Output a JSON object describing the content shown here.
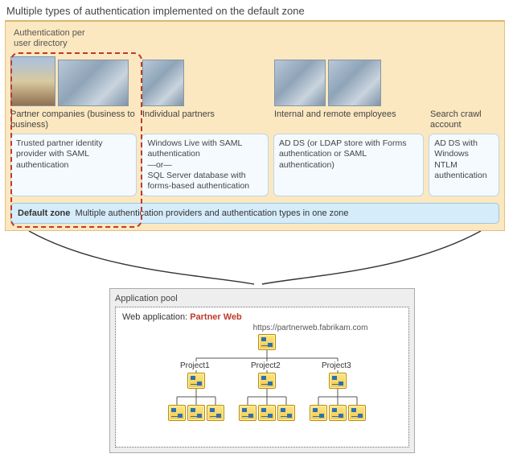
{
  "title": "Multiple types of authentication implemented on the default zone",
  "auth_per": {
    "line1": "Authentication per",
    "line2": "user directory"
  },
  "columns": {
    "c1": {
      "label": "Partner companies (business to business)"
    },
    "c2": {
      "label": "Individual partners"
    },
    "c3": {
      "label": "Internal and remote employees"
    },
    "c4": {
      "label": "Search crawl account"
    }
  },
  "auth_boxes": {
    "b1": "Trusted partner identity provider with SAML authentication",
    "b2": "Windows Live with SAML authentication\n—or—\nSQL Server database with forms-based authentication",
    "b3": "AD DS  (or LDAP store with Forms authentication or SAML authentication)",
    "b4": "AD DS with Windows NTLM authentication"
  },
  "zone": {
    "label": "Default zone",
    "desc": "Multiple authentication providers and authentication types in one zone"
  },
  "app_pool": {
    "title": "Application pool",
    "webapp_label": "Web application:",
    "webapp_name": "Partner Web",
    "url": "https://partnerweb.fabrikam.com",
    "projects": [
      "Project1",
      "Project2",
      "Project3"
    ]
  }
}
